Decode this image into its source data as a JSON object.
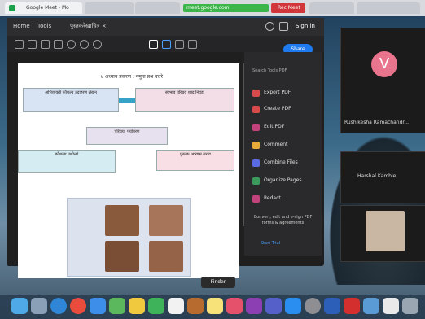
{
  "browser": {
    "tab_title": "Google Meet - Mo",
    "url": "meet.google.com",
    "red_tab": "Rec Meet"
  },
  "app": {
    "menu": [
      "Home",
      "Tools",
      "पुस्तकरेखाचित्र ×"
    ],
    "signin": "Sign in",
    "share": "Share"
  },
  "document": {
    "heading": "७ अध्याय प्रकरण : नमुना प्रश्न उत्तरे",
    "boxes": [
      "अभिव्यक्ती कौशल्य उदाहरण लेखन",
      "स्वभाव परिचय शब्द निवडा",
      "परिचय: पर्यावरण",
      "कौशल्य प्रश्नोत्तरे",
      "पुस्तक अभ्यास सराव"
    ]
  },
  "panel": {
    "title": "Search Tools PDF",
    "items": [
      "Export PDF",
      "Create PDF",
      "Edit PDF",
      "Comment",
      "Combine Files",
      "Organize Pages",
      "Redact"
    ],
    "promo": "Convert, edit and e-sign PDF forms & agreements",
    "link": "Start Trial"
  },
  "call": {
    "participants": [
      {
        "name": "Rushikesha Ramachandr...",
        "initial": "V"
      },
      {
        "name": "Harshal Kamble"
      },
      {
        "name": ""
      }
    ]
  },
  "dock": {
    "tooltip": "Finder",
    "icons": [
      "finder-icon",
      "launchpad-icon",
      "safari-icon",
      "chrome-icon",
      "mail-icon",
      "maps-icon",
      "photos-icon",
      "facetime-icon",
      "calendar-icon",
      "contacts-icon",
      "notes-icon",
      "music-icon",
      "onenote-icon",
      "teams-icon",
      "appstore-icon",
      "settings-icon",
      "word-icon",
      "acrobat-icon",
      "files-icon",
      "notes2-icon",
      "trash-icon"
    ]
  }
}
